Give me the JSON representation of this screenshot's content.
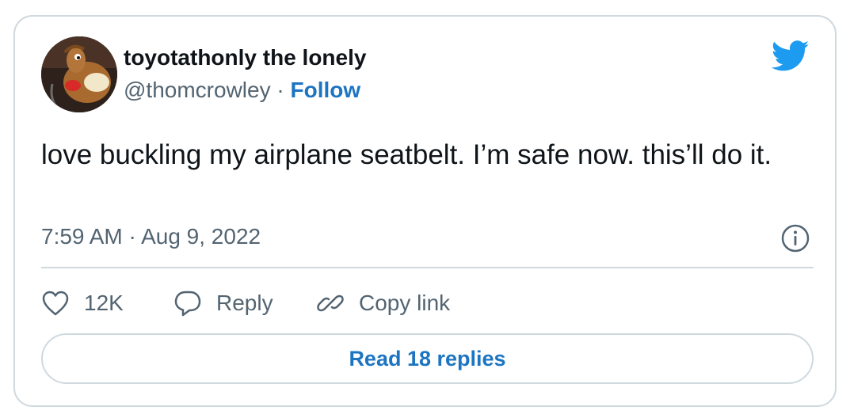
{
  "author": {
    "display_name": "toyotathonly the lonely",
    "handle": "@thomcrowley",
    "separator": " · ",
    "follow_label": "Follow"
  },
  "tweet": {
    "text": "love buckling my airplane seatbelt. I’m safe now. this’ll do it.",
    "timestamp": "7:59 AM · Aug 9, 2022"
  },
  "actions": {
    "like_count": "12K",
    "reply_label": "Reply",
    "copy_link_label": "Copy link"
  },
  "read_replies_label": "Read 18 replies",
  "icons": {
    "brand": "twitter-bird-icon",
    "info": "info-icon",
    "like": "heart-icon",
    "reply": "speech-bubble-icon",
    "copy": "link-icon"
  },
  "colors": {
    "brand_blue": "#1d9bf0",
    "link_blue": "#1d75c2",
    "text": "#0f1419",
    "secondary": "#536471",
    "border": "#cfd9de"
  }
}
